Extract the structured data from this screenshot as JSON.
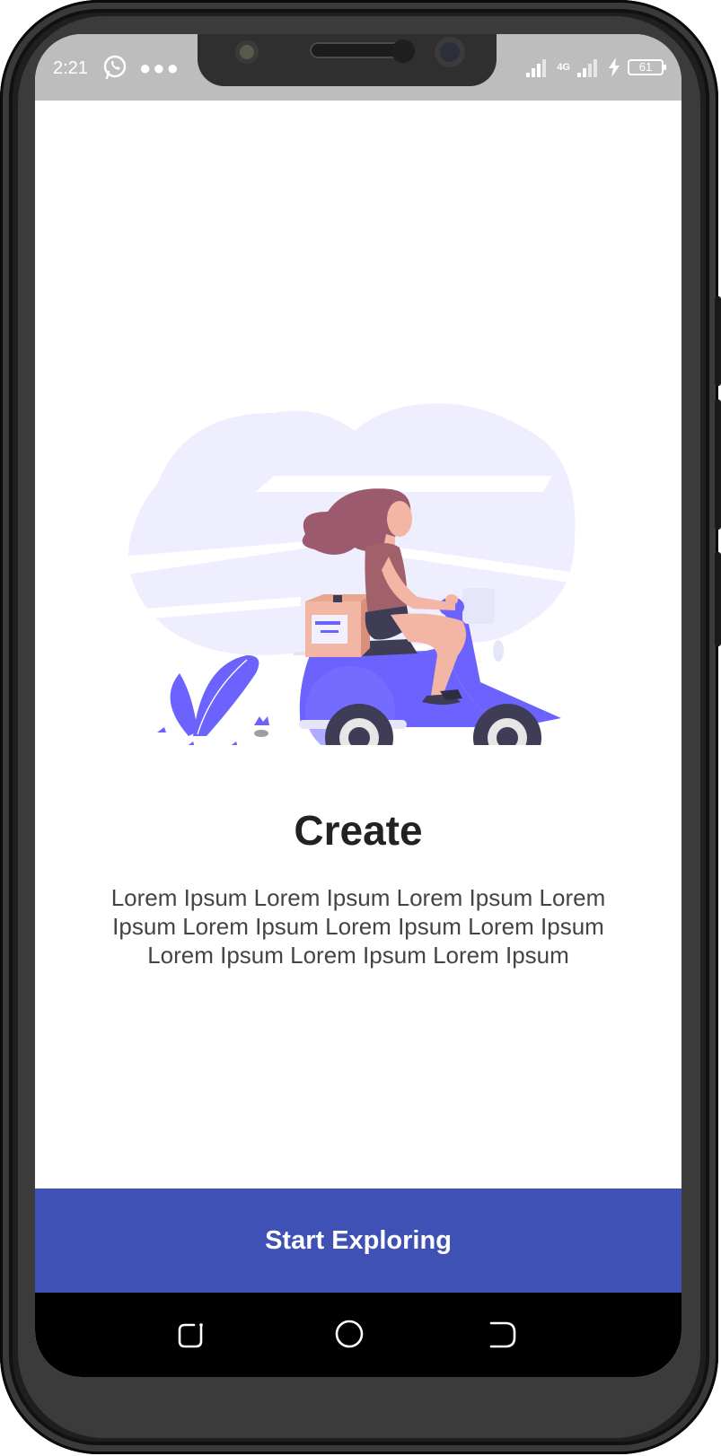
{
  "status_bar": {
    "time": "2:21",
    "network": "4G",
    "battery_level": "61",
    "icons": [
      "whatsapp-icon",
      "more-dots-icon",
      "signal-icon",
      "charging-bolt-icon",
      "battery-icon"
    ]
  },
  "onboarding": {
    "title": "Create",
    "description": "Lorem Ipsum Lorem Ipsum Lorem Ipsum Lorem Ipsum Lorem Ipsum Lorem Ipsum Lorem Ipsum Lorem Ipsum Lorem Ipsum Lorem Ipsum",
    "cta_label": "Start Exploring",
    "illustration": "woman-on-scooter-delivery-illustration"
  },
  "nav_bar": {
    "icons": [
      "recent-apps-icon",
      "home-icon",
      "back-icon"
    ]
  },
  "colors": {
    "primary": "#3f51b5",
    "illustration_accent": "#6c63ff",
    "illustration_bg": "#efeefe",
    "status_bar_bg": "#bdbdbd"
  }
}
